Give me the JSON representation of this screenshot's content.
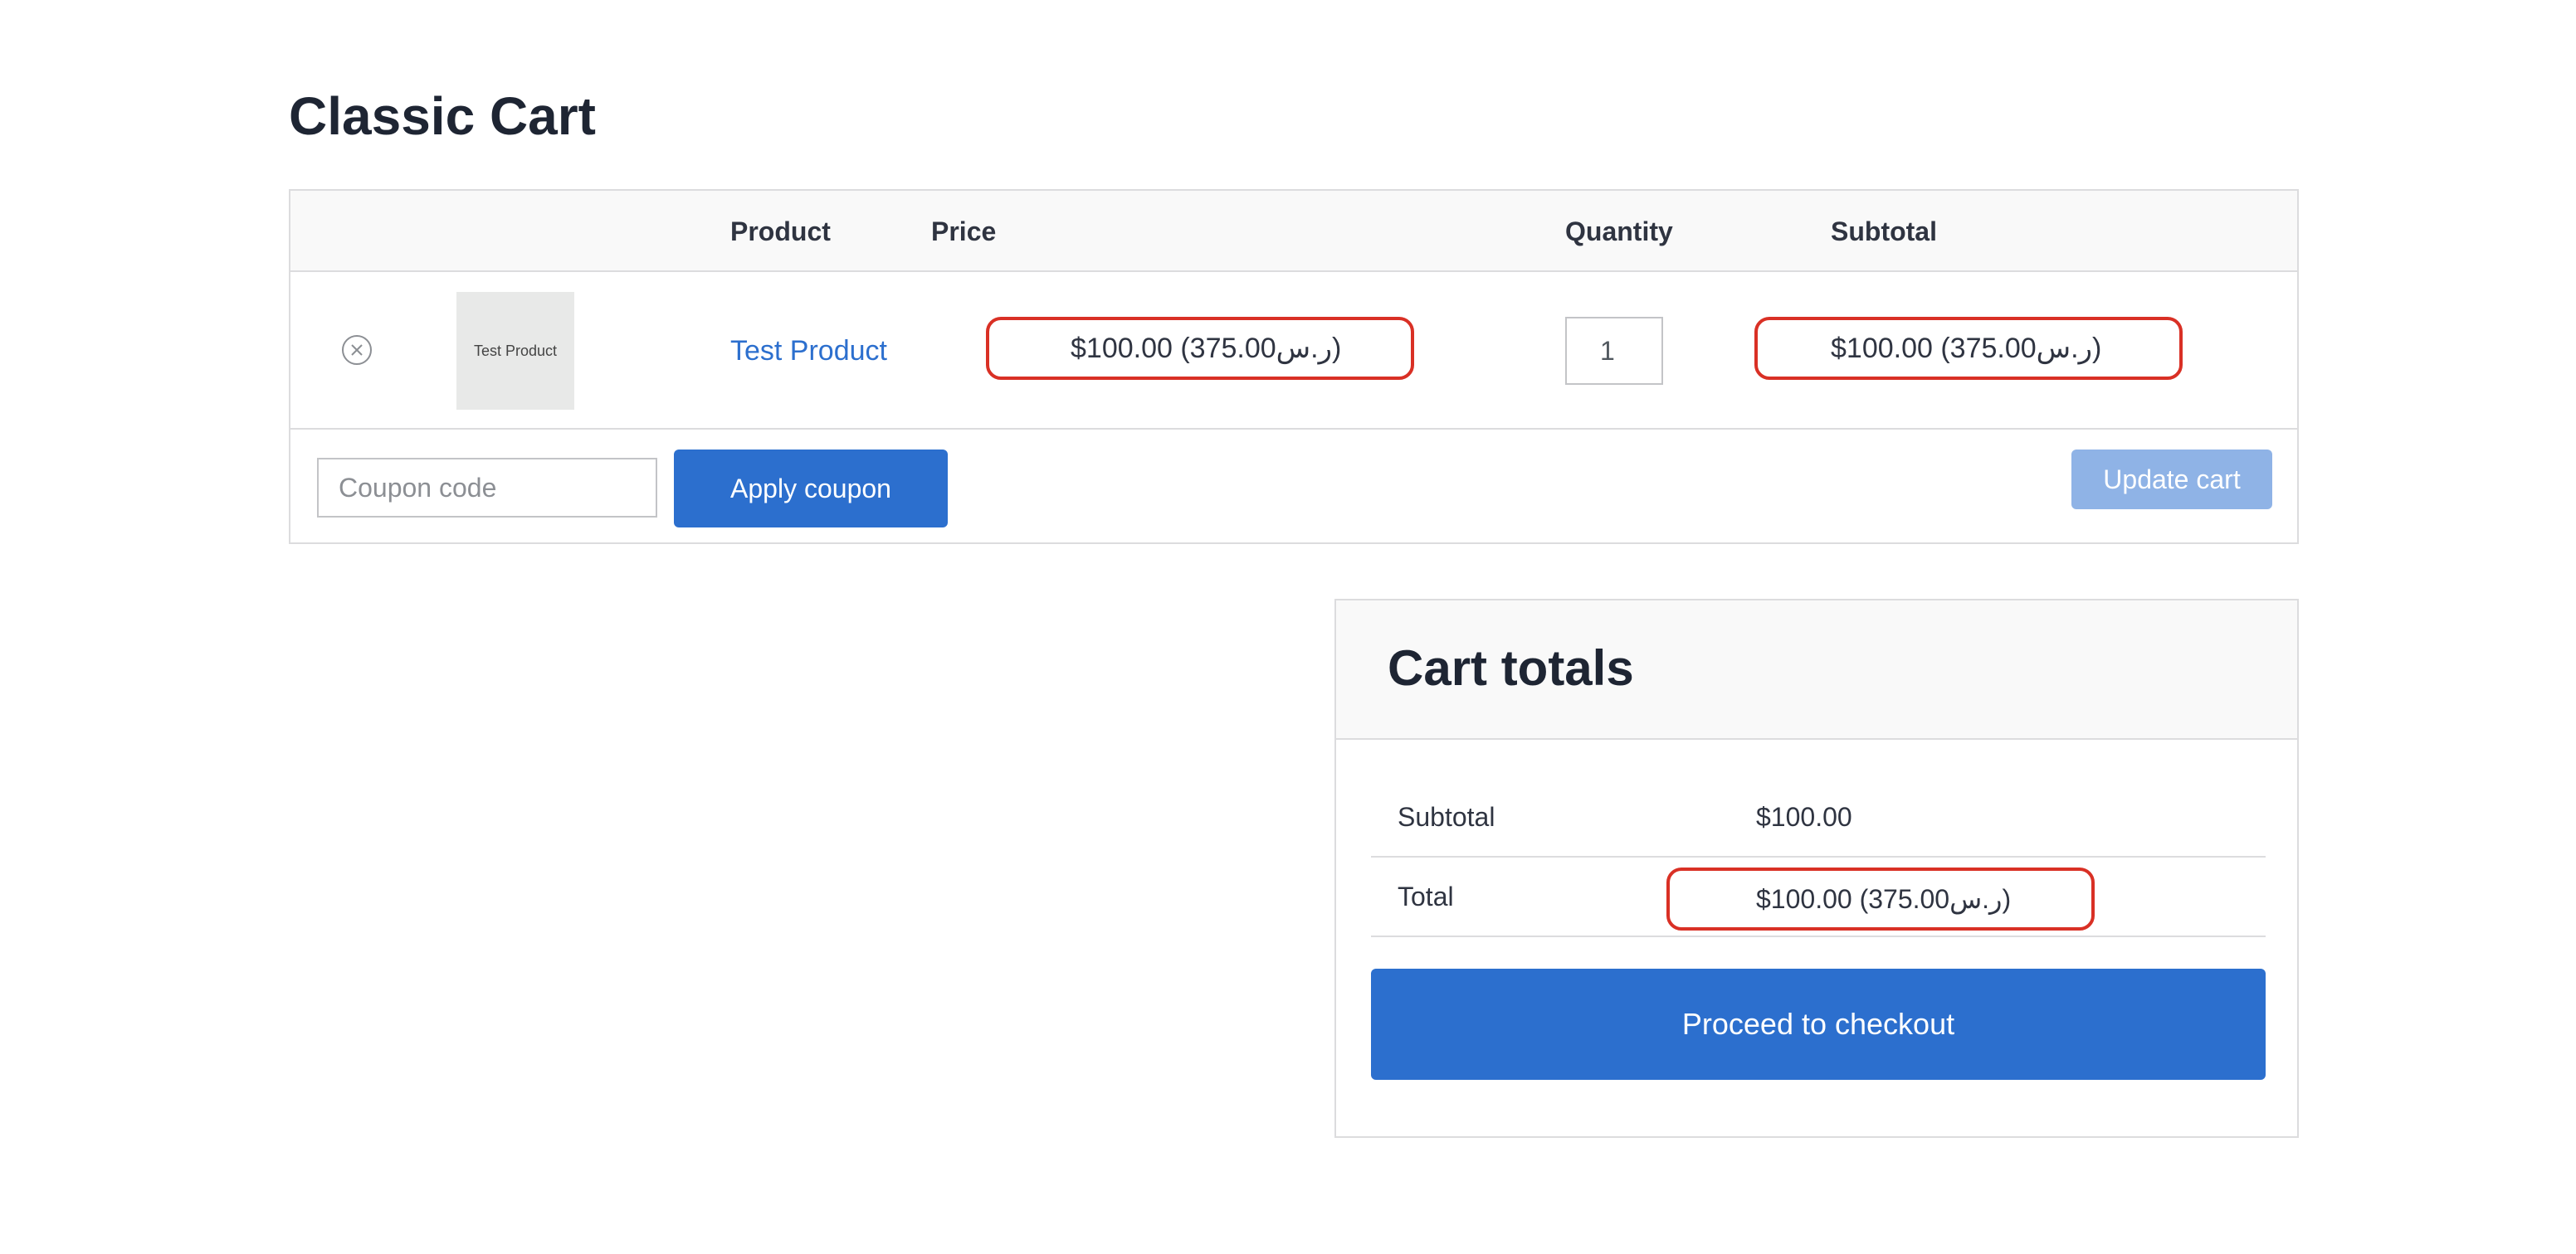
{
  "page": {
    "title": "Classic Cart"
  },
  "cart": {
    "columns": [
      "",
      "",
      "Product",
      "Price",
      "Quantity",
      "Subtotal"
    ],
    "items": [
      {
        "thumbnail_text": "Test Product",
        "name": "Test Product",
        "price": "$100.00 (375.00ر.س)",
        "quantity": "1",
        "subtotal": "$100.00 (375.00ر.س)"
      }
    ],
    "coupon": {
      "placeholder": "Coupon code",
      "value": ""
    },
    "apply_coupon_label": "Apply coupon",
    "update_cart_label": "Update cart"
  },
  "totals": {
    "title": "Cart totals",
    "subtotal_label": "Subtotal",
    "subtotal_value": "$100.00",
    "total_label": "Total",
    "total_value": "$100.00 (375.00ر.س)",
    "checkout_label": "Proceed to checkout"
  },
  "colors": {
    "accent": "#2c6fce",
    "accent_disabled": "#8fb3e6",
    "highlight": "#d93025",
    "heading": "#1e2533"
  },
  "icons": {
    "remove": "remove-circle-x-icon"
  }
}
